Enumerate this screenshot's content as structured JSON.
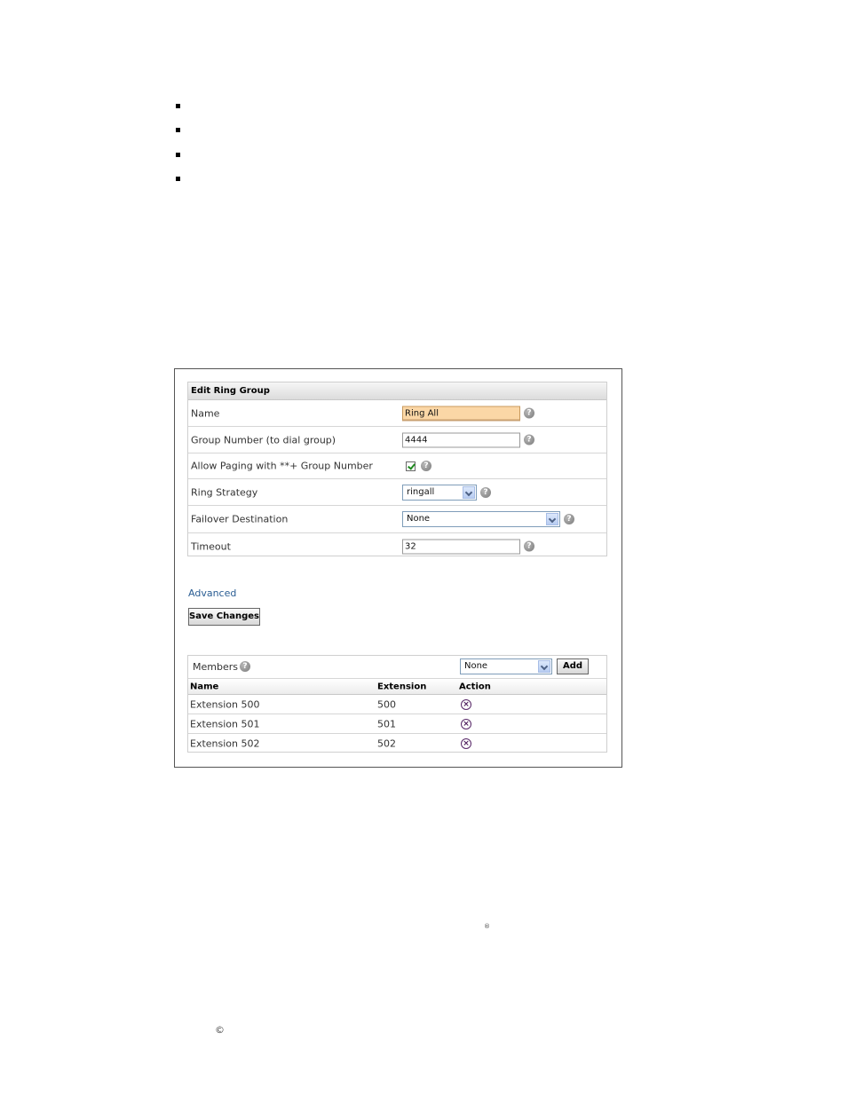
{
  "doc": {
    "registered_mark": "®",
    "copyright_mark": "©"
  },
  "form": {
    "title": "Edit Ring Group",
    "fields": {
      "name": {
        "label": "Name",
        "value": "Ring All"
      },
      "group_number": {
        "label": "Group Number (to dial group)",
        "value": "4444"
      },
      "allow_paging": {
        "label": "Allow Paging with **+ Group Number",
        "checked": true
      },
      "ring_strategy": {
        "label": "Ring Strategy",
        "value": "ringall"
      },
      "failover": {
        "label": "Failover Destination",
        "value": "None"
      },
      "timeout": {
        "label": "Timeout",
        "value": "32"
      }
    },
    "help_glyph": "?",
    "advanced_link": "Advanced",
    "save_button": "Save Changes"
  },
  "members": {
    "label": "Members",
    "select_value": "None",
    "add_button": "Add",
    "columns": [
      "Name",
      "Extension",
      "Action"
    ],
    "rows": [
      {
        "name": "Extension 500",
        "extension": "500"
      },
      {
        "name": "Extension 501",
        "extension": "501"
      },
      {
        "name": "Extension 502",
        "extension": "502"
      }
    ],
    "delete_glyph": "×"
  }
}
